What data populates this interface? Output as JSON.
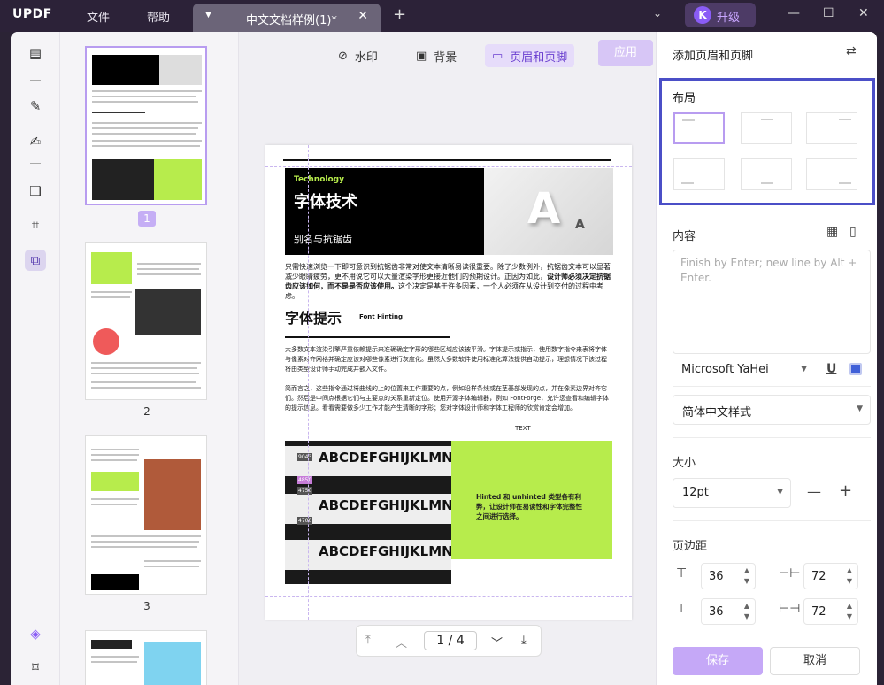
{
  "app": {
    "logo": "UPDF",
    "menu": [
      "文件",
      "帮助"
    ],
    "tab_title": "中文文档样例(1)*",
    "upgrade_avatar": "K",
    "upgrade_label": "升级"
  },
  "toolbar": {
    "watermark": "水印",
    "background": "背景",
    "header_footer": "页眉和页脚",
    "apply": "应用"
  },
  "thumbnails": {
    "pages": [
      "1",
      "2",
      "3"
    ]
  },
  "pager": {
    "current": "1",
    "sep": "/",
    "total": "4"
  },
  "page_preview": {
    "tag": "Technology",
    "title": "字体技术",
    "subtitle": "别名与抗锯齿",
    "para1": "只需快速浏览一下即可意识到抗锯齿非常对使文本清晰易读很重要。除了少数例外，抗锯齿文本可以显著减少眼睛疲劳，更不用说它可以大量渲染字形更接近他们的预期设计。正因为如此，",
    "para1_bold": "设计师必须决定抗锯齿应该如何，而不是是否应该使用。",
    "para1_end": "这个决定是基于许多因素，一个人必须在从设计到交付的过程中考虑。",
    "heading2": "字体提示",
    "heading2_en": "Font Hinting",
    "para2": "大多数文本渲染引擎严重依赖提示来准确确定字形的哪些区域应该被平滑。字体提示或指示，使用数字指令来表将字体与像素对齐网格并确定应该对哪些像素进行灰度化。虽然大多数软件使用标准化算法提供自动提示，理想情况下该过程将由类型设计师手动完成并嵌入文件。",
    "para3": "简而言之，这些指令通过将曲线的上的位置来工作重要的点，例如沿样条线或在茎基部发现的点，并在像素边界对齐它们。然后是中间点根据它们与主要点的关系重新定位。使用开源字体编辑器，例如 FontForge，允许您查看和编辑字体的提示信息。看看需要做多少工作才能产生清晰的字形；您对字体设计师和字体工程师的欣赏肯定会增加。",
    "text_label": "TEXT",
    "alpha_big": "A",
    "alpha_small": "A",
    "banner_text": "ABCDEFGHIJKLMNO",
    "banner_tags": [
      "9043",
      "4850",
      "4750",
      "4700"
    ],
    "green_text": "Hinted 和 unhinted 类型各有利弊，让设计师在易读性和字体完整性之间进行选择。"
  },
  "right_panel": {
    "title": "添加页眉和页脚",
    "layout_label": "布局",
    "content_label": "内容",
    "content_placeholder": "Finish by Enter; new line by Alt + Enter.",
    "font": "Microsoft YaHei",
    "underline_glyph": "U",
    "style": "简体中文样式",
    "size_label": "大小",
    "size_value": "12pt",
    "margin_label": "页边距",
    "margins": {
      "top": "36",
      "left_right_a": "72",
      "bottom": "36",
      "left_right_b": "72"
    },
    "save": "保存",
    "cancel": "取消"
  },
  "colors": {
    "accent": "#b89cf0",
    "highlight_border": "#4b4fc7",
    "green": "#b7ec4c"
  }
}
